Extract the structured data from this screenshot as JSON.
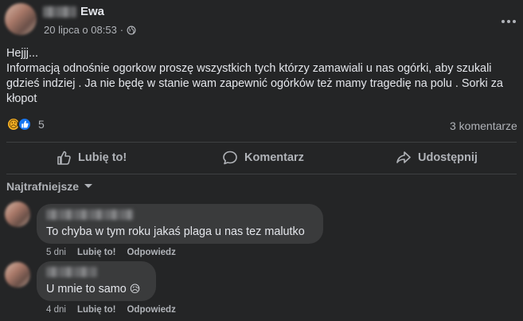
{
  "post": {
    "author": "Ewa",
    "date": "20 lipca o 08:53",
    "dot": "·",
    "text": [
      "Hejjj...",
      "Informacją odnośnie ogorkow  proszę wszystkich tych którzy zamawiali u nas ogórki, aby szukali gdzieś indziej .   Ja nie będę w stanie wam zapewnić ogórków też mamy tragedię na polu . Sorki za kłopot"
    ],
    "reaction_count": "5",
    "reaction_icons": [
      "sad-emoji-icon",
      "like-thumb-icon"
    ],
    "comments_count": "3 komentarze"
  },
  "actions": {
    "like": "Lubię to!",
    "comment": "Komentarz",
    "share": "Udostępnij"
  },
  "sort": {
    "label": "Najtrafniejsze"
  },
  "comments": [
    {
      "text": "To chyba w tym roku jakaś plaga u nas tez malutko",
      "age": "5 dni",
      "like": "Lubię to!",
      "reply": "Odpowiedz"
    },
    {
      "text": "U mnie to samo",
      "emoji": "😥",
      "age": "4 dni",
      "like": "Lubię to!",
      "reply": "Odpowiedz"
    }
  ],
  "colors": {
    "background": "#242526",
    "bubble": "#3a3b3c",
    "text_primary": "#e4e6eb",
    "text_secondary": "#b0b3b8",
    "like_blue": "#1877f2",
    "sad_yellow": "#f7b125"
  }
}
